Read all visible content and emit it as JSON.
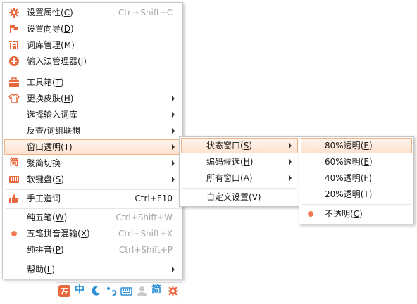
{
  "ui": {
    "menu1": [
      {
        "label": "设置属性",
        "key": "C",
        "shortcut": "Ctrl+Shift+C",
        "icon": "gear-icon"
      },
      {
        "label": "设置向导",
        "key": "D",
        "icon": "flag-icon"
      },
      {
        "label": "词库管理",
        "key": "M",
        "icon": "ci-icon"
      },
      {
        "label": "输入法管理器",
        "key": "J",
        "icon": "ime-manager-icon"
      },
      {
        "label": "工具箱",
        "key": "T",
        "icon": "toolbox-icon"
      },
      {
        "label": "更换皮肤",
        "key": "H",
        "icon": "shirt-icon",
        "submenu": true
      },
      {
        "label": "选择输入词库",
        "submenu": true
      },
      {
        "label": "反查/词组联想",
        "submenu": true
      },
      {
        "label": "窗口透明",
        "key": "T",
        "submenu": true,
        "highlighted": true
      },
      {
        "label": "繁简切换",
        "icon": "jian-icon",
        "icon_text": "简",
        "submenu": true
      },
      {
        "label": "软键盘",
        "key": "S",
        "icon": "keyboard-icon",
        "submenu": true
      },
      {
        "label": "手工造词",
        "shortcut": "Ctrl+F10",
        "icon": "thumb-icon"
      },
      {
        "label": "纯五笔",
        "key": "W",
        "shortcut": "Ctrl+Shift+W"
      },
      {
        "label": "五笔拼音混输",
        "key": "X",
        "shortcut": "Ctrl+Shift+X",
        "selected": true
      },
      {
        "label": "纯拼音",
        "key": "P",
        "shortcut": "Ctrl+Shift+P"
      },
      {
        "label": "帮助",
        "key": "L",
        "submenu": true
      }
    ],
    "menu2": [
      {
        "label": "状态窗口",
        "key": "S",
        "submenu": true,
        "highlighted": true
      },
      {
        "label": "编码候选",
        "key": "H",
        "submenu": true
      },
      {
        "label": "所有窗口",
        "key": "A",
        "submenu": true
      },
      {
        "label": "自定义设置",
        "key": "V"
      }
    ],
    "menu3": [
      {
        "label": "80%透明",
        "key": "E",
        "highlighted": true
      },
      {
        "label": "60%透明",
        "key": "E"
      },
      {
        "label": "40%透明",
        "key": "F"
      },
      {
        "label": "20%透明",
        "key": "T"
      },
      {
        "label": "不透明",
        "key": "C",
        "selected": true
      }
    ],
    "statusbar": {
      "mode_label": "中",
      "jian_label": "简",
      "icons": [
        "logo-icon",
        "chinese-mode-icon",
        "half-moon-icon",
        "punctuation-icon",
        "keyboard-icon",
        "user-icon",
        "jian-icon",
        "settings-icon"
      ]
    },
    "colors": {
      "accent": "#e9683d",
      "mode_blue": "#2b8fd6",
      "highlight_border": "#f1b48a",
      "highlight_bg": "#fde2cf",
      "shortcut_gray": "#a7a7a7"
    }
  }
}
